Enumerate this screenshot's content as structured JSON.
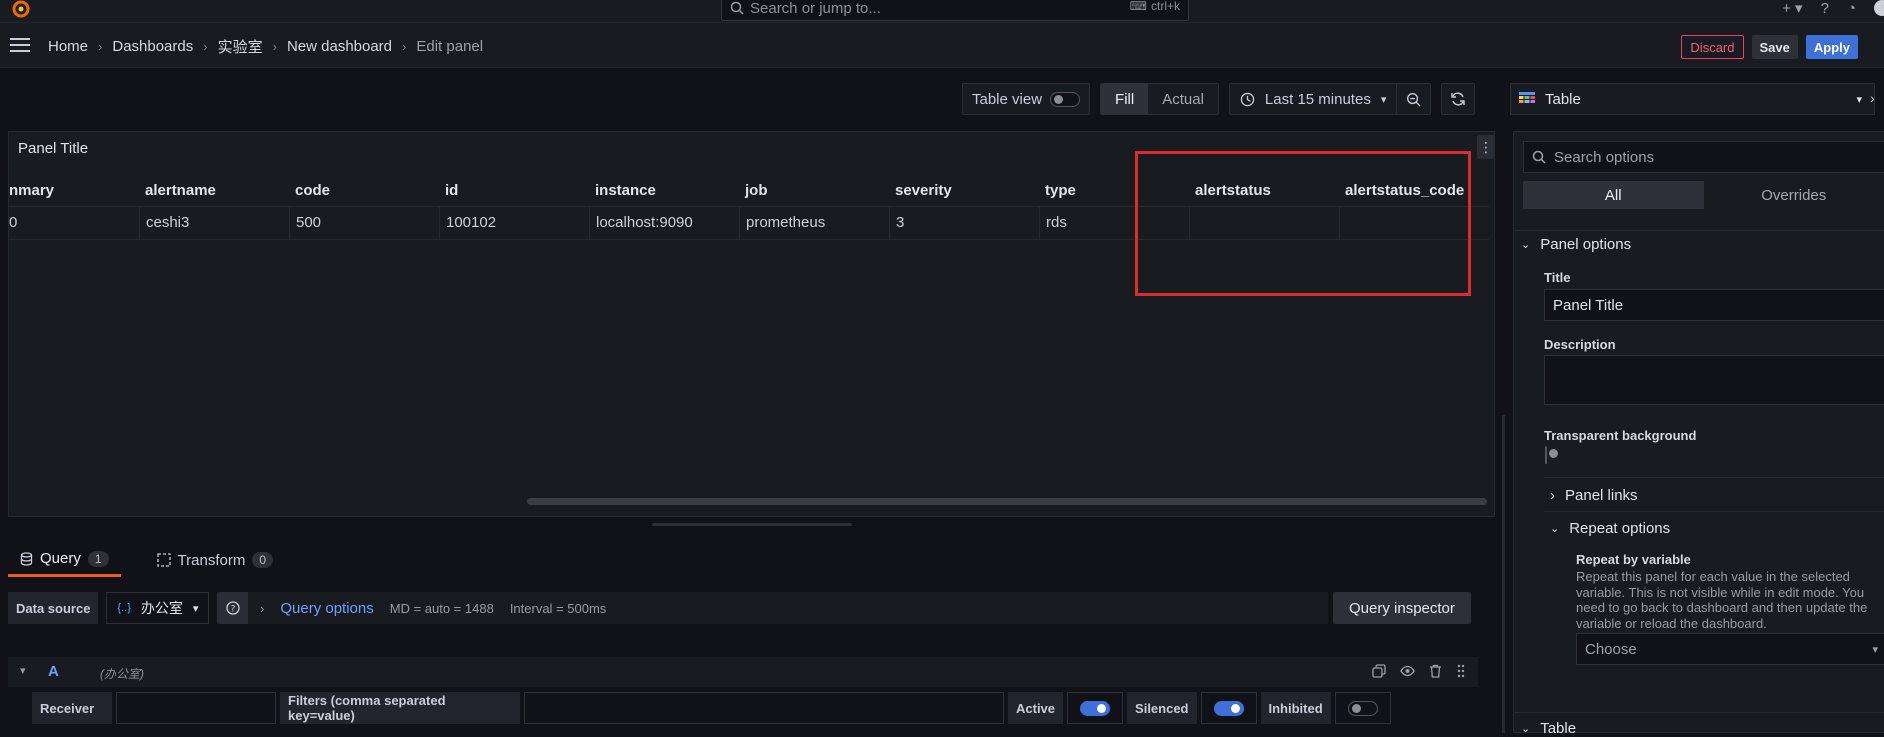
{
  "topbar": {
    "search_placeholder": "Search or jump to...",
    "shortcut": "ctrl+k",
    "icons": [
      "grafana-logo-icon",
      "plus-icon",
      "help-icon",
      "news-icon",
      "avatar"
    ]
  },
  "breadcrumbs": [
    "Home",
    "Dashboards",
    "实验室",
    "New dashboard",
    "Edit panel"
  ],
  "actions": {
    "discard": "Discard",
    "save": "Save",
    "apply": "Apply"
  },
  "toolbar": {
    "table_view": "Table view",
    "fill": "Fill",
    "actual": "Actual",
    "time_range": "Last 15 minutes"
  },
  "panel": {
    "title": "Panel Title",
    "columns": [
      "nmary",
      "alertname",
      "code",
      "id",
      "instance",
      "job",
      "severity",
      "type",
      "alertstatus",
      "alertstatus_code"
    ],
    "rows": [
      [
        "0",
        "ceshi3",
        "500",
        "100102",
        "localhost:9090",
        "prometheus",
        "3",
        "rds",
        "",
        ""
      ]
    ]
  },
  "query_tabs": [
    {
      "label": "Query",
      "count": "1"
    },
    {
      "label": "Transform",
      "count": "0"
    }
  ],
  "query": {
    "datasource_label": "Data source",
    "datasource": "办公室",
    "options_label": "Query options",
    "md": "MD = auto = 1488",
    "interval": "Interval = 500ms",
    "inspector": "Query inspector",
    "ref_id": "A",
    "ref_ds": "(办公室)",
    "receiver_label": "Receiver",
    "filters_label": "Filters (comma separated key=value)",
    "active_label": "Active",
    "silenced_label": "Silenced",
    "inhibited_label": "Inhibited",
    "active_on": true,
    "silenced_on": true,
    "inhibited_on": false
  },
  "options": {
    "visualization": "Table",
    "search_placeholder": "Search options",
    "tabs": [
      "All",
      "Overrides"
    ],
    "panel_options": "Panel options",
    "title_label": "Title",
    "title_value": "Panel Title",
    "description_label": "Description",
    "transparent_label": "Transparent background",
    "panel_links": "Panel links",
    "repeat_options": "Repeat options",
    "repeat_by_variable": "Repeat by variable",
    "repeat_help": "Repeat this panel for each value in the selected variable. This is not visible while in edit mode. You need to go back to dashboard and then update the variable or reload the dashboard.",
    "choose": "Choose",
    "table_section": "Table"
  },
  "colors": {
    "accent": "#3d71d9",
    "highlight": "#e02b2b",
    "tab_underline": "#f05a28",
    "danger": "#f03e5e"
  }
}
